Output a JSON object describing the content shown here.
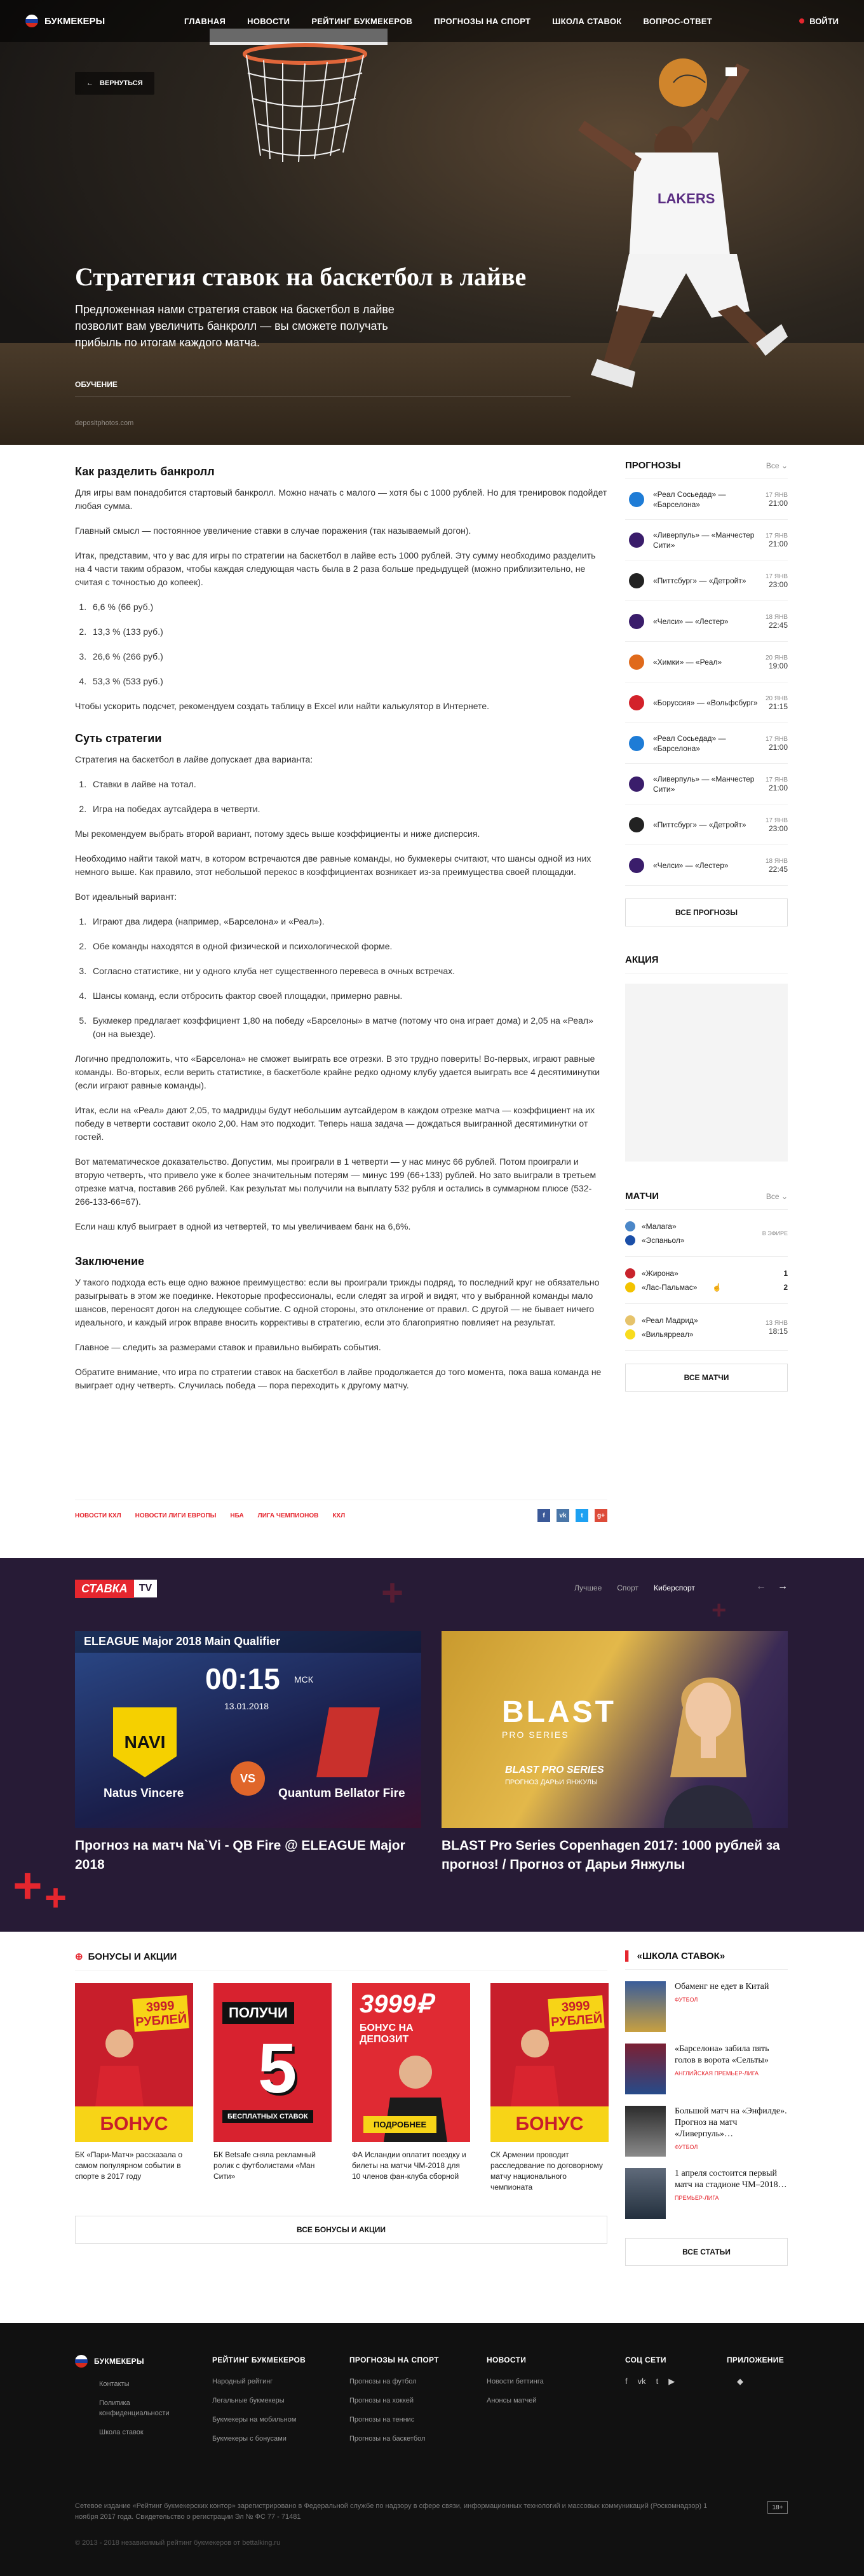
{
  "brand": "БУКМЕКЕРЫ",
  "nav": [
    "ГЛАВНАЯ",
    "НОВОСТИ",
    "РЕЙТИНГ БУКМЕКЕРОВ",
    "ПРОГНОЗЫ НА СПОРТ",
    "ШКОЛА СТАВОК",
    "ВОПРОС-ОТВЕТ"
  ],
  "login": "ВОЙТИ",
  "hero": {
    "back": "ВЕРНУТЬСЯ",
    "title": "Стратегия ставок на баскетбол в лайве",
    "lead": "Предложенная нами стратегия ставок на баскетбол в лайве позволит вам увеличить банкролл — вы сможете получать прибыль по итогам каждого матча.",
    "category": "ОБУЧЕНИЕ",
    "credit": "depositphotos.com"
  },
  "article": {
    "h1": "Как разделить банкролл",
    "p1": "Для игры вам понадобится стартовый банкролл. Можно начать с малого — хотя бы с 1000 рублей. Но для тренировок подойдет любая сумма.",
    "p2": "Главный смысл — постоянное увеличение ставки в случае поражения (так называемый догон).",
    "p3": "Итак, представим, что у вас для игры по стратегии на баскетбол в лайве есть 1000 рублей. Эту сумму необходимо разделить на 4 части таким образом, чтобы каждая следующая часть была в 2 раза больше предыдущей (можно приблизительно, не считая с точностью до копеек).",
    "list1": [
      "6,6 % (66 руб.)",
      "13,3 % (133 руб.)",
      "26,6 % (266 руб.)",
      "53,3 % (533 руб.)"
    ],
    "p4": "Чтобы ускорить подсчет, рекомендуем создать таблицу в Excel или найти калькулятор в Интернете.",
    "h2": "Суть стратегии",
    "p5": "Стратегия на баскетбол в лайве допускает два варианта:",
    "list2": [
      "Ставки в лайве на тотал.",
      "Игра на победах аутсайдера в четверти."
    ],
    "p6": "Мы рекомендуем выбрать второй вариант, потому здесь выше коэффициенты и ниже дисперсия.",
    "p7": "Необходимо найти такой матч, в котором встречаются две равные команды, но букмекеры считают, что шансы одной из них немного выше. Как правило, этот небольшой перекос в коэффициентах возникает из-за преимущества своей площадки.",
    "p8": "Вот идеальный вариант:",
    "list3": [
      "Играют два лидера (например, «Барселона» и «Реал»).",
      "Обе команды находятся в одной физической и психологической форме.",
      "Согласно статистике, ни у одного клуба нет существенного перевеса в очных встречах.",
      "Шансы команд, если отбросить фактор своей площадки, примерно равны.",
      "Букмекер предлагает коэффициент 1,80 на победу «Барселоны» в матче (потому что она играет дома) и 2,05 на «Реал» (он на выезде)."
    ],
    "p9": "Логично предположить, что «Барселона» не сможет выиграть все отрезки. В это трудно поверить! Во-первых, играют равные команды. Во-вторых, если верить статистике, в баскетболе крайне редко одному клубу удается выиграть все 4 десятиминутки (если играют равные команды).",
    "p10": "Итак, если на «Реал» дают 2,05, то мадридцы будут небольшим аутсайдером в каждом отрезке матча — коэффициент на их победу в четверти составит около 2,00. Нам это подходит. Теперь наша задача — дождаться выигранной десятиминутки от гостей.",
    "p11": "Вот математическое доказательство. Допустим, мы проиграли в 1 четверти — у нас минус 66 рублей. Потом проиграли и вторую четверть, что привело уже к более значительным потерям — минус 199 (66+133) рублей. Но зато выиграли в третьем отрезке матча, поставив 266 рублей. Как результат мы получили на выплату 532 рубля и остались в суммарном плюсе (532-266-133-66=67).",
    "p12": "Если наш клуб выиграет в одной из четвертей, то мы увеличиваем банк на 6,6%.",
    "h3": "Заключение",
    "p13": "У такого подхода есть еще одно важное преимущество: если вы проиграли трижды подряд, то последний круг не обязательно разыгрывать в этом же поединке. Некоторые профессионалы, если следят за игрой и видят, что у выбранной команды мало шансов, переносят догон на следующее событие. С одной стороны, это отклонение от правил. С другой — не бывает ничего идеального, и каждый игрок вправе вносить коррективы в стратегию, если это благоприятно повлияет на результат.",
    "p14": "Главное — следить за размерами ставок и правильно выбирать события.",
    "p15": "Обратите внимание, что игра по стратегии ставок на баскетбол в лайве продолжается до того момента, пока ваша команда не выиграет одну четверть. Случилась победа — пора переходить к другому матчу."
  },
  "tags": [
    "НОВОСТИ КХЛ",
    "НОВОСТИ ЛИГИ ЕВРОПЫ",
    "НБА",
    "ЛИГА ЧЕМПИОНОВ",
    "КХЛ"
  ],
  "share_icons": [
    "facebook-icon",
    "vk-icon",
    "twitter-icon",
    "googleplus-icon"
  ],
  "forecasts": {
    "title": "ПРОГНОЗЫ",
    "filter": "Все",
    "items": [
      {
        "teams": "«Реал Сосьедад» — «Барселона»",
        "date": "17 ЯНВ",
        "time": "21:00",
        "c": "#1e7cd6"
      },
      {
        "teams": "«Ливерпуль» — «Манчестер Сити»",
        "date": "17 ЯНВ",
        "time": "21:00",
        "c": "#3a1d6b"
      },
      {
        "teams": "«Питтсбург» — «Детройт»",
        "date": "17 ЯНВ",
        "time": "23:00",
        "c": "#222"
      },
      {
        "teams": "«Челси» — «Лестер»",
        "date": "18 ЯНВ",
        "time": "22:45",
        "c": "#3a1d6b"
      },
      {
        "teams": "«Химки» — «Реал»",
        "date": "20 ЯНВ",
        "time": "19:00",
        "c": "#e06a1b"
      },
      {
        "teams": "«Боруссия» — «Вольфсбург»",
        "date": "20 ЯНВ",
        "time": "21:15",
        "c": "#d3222a"
      },
      {
        "teams": "«Реал Сосьедад» — «Барселона»",
        "date": "17 ЯНВ",
        "time": "21:00",
        "c": "#1e7cd6"
      },
      {
        "teams": "«Ливерпуль» — «Манчестер Сити»",
        "date": "17 ЯНВ",
        "time": "21:00",
        "c": "#3a1d6b"
      },
      {
        "teams": "«Питтсбург» — «Детройт»",
        "date": "17 ЯНВ",
        "time": "23:00",
        "c": "#222"
      },
      {
        "teams": "«Челси» — «Лестер»",
        "date": "18 ЯНВ",
        "time": "22:45",
        "c": "#3a1d6b"
      }
    ],
    "all": "ВСЕ ПРОГНОЗЫ"
  },
  "promo": {
    "title": "АКЦИЯ"
  },
  "matches": {
    "title": "МАТЧИ",
    "filter": "Все",
    "items": [
      {
        "home": "«Малага»",
        "away": "«Эспаньол»",
        "status": "В ЭФИРЕ",
        "s1": "",
        "s2": "",
        "date": "",
        "time": ""
      },
      {
        "home": "«Жирона»",
        "away": "«Лас-Пальмас»",
        "status": "",
        "s1": "1",
        "s2": "2",
        "date": "",
        "time": ""
      },
      {
        "home": "«Реал Мадрид»",
        "away": "«Вильярреал»",
        "status": "",
        "s1": "",
        "s2": "",
        "date": "13 ЯНВ",
        "time": "18:15"
      }
    ],
    "all": "ВСЕ МАТЧИ"
  },
  "tv": {
    "logo_a": "СТАВКА",
    "logo_b": "TV",
    "tabs": [
      "Лучшее",
      "Спорт",
      "Киберспорт"
    ],
    "active_tab": "Киберспорт",
    "card1": {
      "banner": "ELEAGUE Major 2018 Main Qualifier",
      "time": "00:15",
      "tz": "МСК",
      "date": "13.01.2018",
      "team1": "Natus Vincere",
      "team2": "Quantum Bellator Fire",
      "vs": "VS",
      "title": "Прогноз на матч Na`Vi - QB Fire @ ELEAGUE Major 2018"
    },
    "card2": {
      "brand": "BLAST",
      "brand2": "PRO SERIES",
      "sub": "BLAST PRO SERIES",
      "sub2": "ПРОГНОЗ ДАРЬИ ЯНЖУЛЫ",
      "title": "BLAST Pro Series Copenhagen 2017: 1000 рублей за прогноз! / Прогноз от Дарьи Янжулы"
    }
  },
  "bonuses": {
    "title": "БОНУСЫ И АКЦИИ",
    "items": [
      {
        "badge": "3999 РУБЛЕЙ",
        "label": "БОНУС",
        "text": "БК «Пари-Матч» рассказала о самом популярном событии в спорте в 2017 году"
      },
      {
        "badge": "ПОЛУЧИ",
        "big": "5",
        "label": "БЕСПЛАТНЫХ СТАВОК",
        "text": "БК Betsafe сняла рекламный ролик с футболистами «Ман Сити»"
      },
      {
        "badge": "3999₽",
        "label": "БОНУС НА ДЕПОЗИТ",
        "extra": "ПОДРОБНЕЕ",
        "text": "ФА Исландии оплатит поездку и билеты на матчи ЧМ-2018 для 10 членов фан-клуба сборной"
      },
      {
        "badge": "3999 РУБЛЕЙ",
        "label": "БОНУС",
        "text": "СК Армении проводит расследование по договорному матчу национального чемпионата"
      }
    ],
    "all": "ВСЕ БОНУСЫ И АКЦИИ"
  },
  "school": {
    "title": "«ШКОЛА СТАВОК»",
    "items": [
      {
        "title": "Обаменг не едет в Китай",
        "cat": "ФУТБОЛ"
      },
      {
        "title": "«Барселона» забила пять голов в ворота «Сельты»",
        "cat": "АНГЛИЙСКАЯ ПРЕМЬЕР-ЛИГА"
      },
      {
        "title": "Большой матч на «Энфилде». Прогноз на матч «Ливерпуль»…",
        "cat": "ФУТБОЛ"
      },
      {
        "title": "1 апреля состоится первый матч на стадионе ЧМ–2018…",
        "cat": "ПРЕМЬЕР-ЛИГА"
      }
    ],
    "all": "ВСЕ СТАТЬИ"
  },
  "footer": {
    "brand": "БУКМЕКЕРЫ",
    "col1": [
      "Контакты",
      "Политика конфиденциальности",
      "Школа ставок"
    ],
    "col2_title": "РЕЙТИНГ БУКМЕКЕРОВ",
    "col2": [
      "Народный рейтинг",
      "Легальные букмекеры",
      "Букмекеры на мобильном",
      "Букмекеры с бонусами"
    ],
    "col3_title": "ПРОГНОЗЫ НА СПОРТ",
    "col3": [
      "Прогнозы на футбол",
      "Прогнозы на хоккей",
      "Прогнозы на теннис",
      "Прогнозы на баскетбол"
    ],
    "col4_title": "НОВОСТИ",
    "col4": [
      "Новости беттинга",
      "Анонсы матчей"
    ],
    "col5_title": "СОЦ СЕТИ",
    "col6_title": "ПРИЛОЖЕНИЕ",
    "legal": "Сетевое издание «Рейтинг букмекерских контор» зарегистрировано в Федеральной службе по надзору в сфере связи, информационных технологий и массовых коммуникаций (Роскомнадзор) 1 ноября 2017 года. Свидетельство о регистрации Эл № ФС 77 - 71481",
    "age": "18+",
    "copy": "© 2013 - 2018 независимый рейтинг букмекеров от bettalking.ru"
  }
}
